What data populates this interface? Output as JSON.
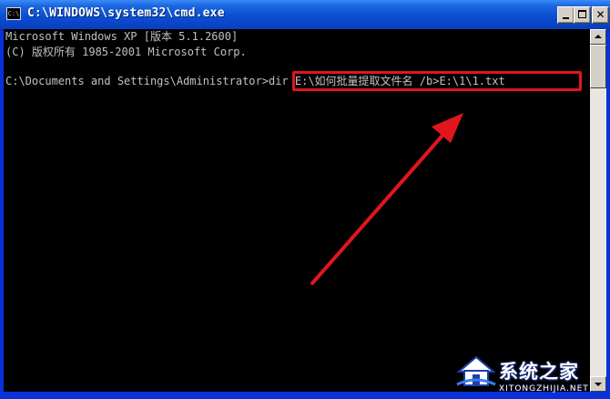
{
  "window": {
    "title": "C:\\WINDOWS\\system32\\cmd.exe",
    "icon_text": "C:\\"
  },
  "console": {
    "lines": [
      "Microsoft Windows XP [版本 5.1.2600]",
      "(C) 版权所有 1985-2001 Microsoft Corp.",
      "",
      "C:\\Documents and Settings\\Administrator>dir E:\\如何批量提取文件名 /b>E:\\1\\1.txt"
    ]
  },
  "highlight": {
    "text": "dir E:\\如何批量提取文件名 /b>E:\\1\\1.txt",
    "color": "#e0161c"
  },
  "watermark": {
    "title": "系统之家",
    "subtitle": "XITONGZHIJIA.NET"
  },
  "icons": {
    "window_icon": "cmd-icon",
    "minimize": "minimize-icon",
    "maximize": "maximize-icon",
    "close": "close-icon"
  },
  "colors": {
    "titlebar": "#0a4fd1",
    "console_bg": "#000000",
    "console_text": "#c0c0c0",
    "annotation": "#e0161c"
  }
}
